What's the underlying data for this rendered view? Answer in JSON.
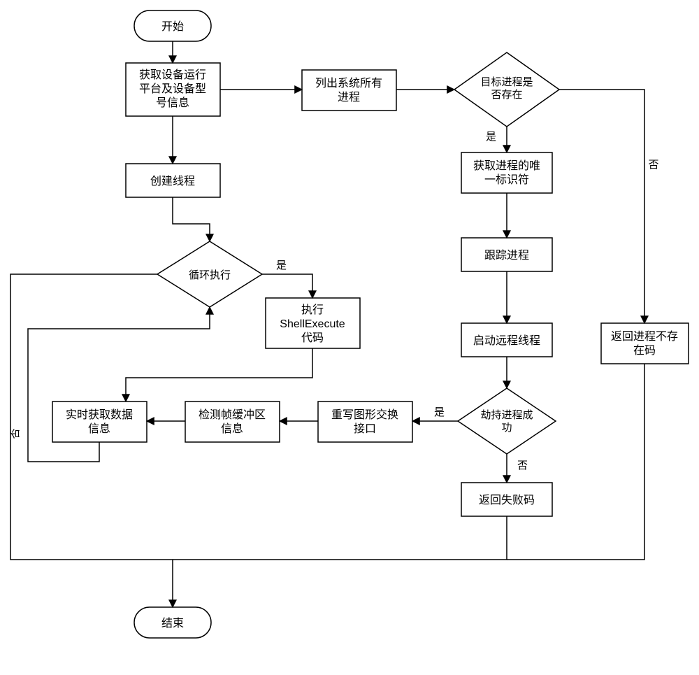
{
  "chart_data": {
    "type": "flowchart",
    "nodes": {
      "start": {
        "kind": "terminator",
        "label": "开始"
      },
      "n1": {
        "kind": "process",
        "label": "获取设备运行平台及设备型号信息"
      },
      "n2": {
        "kind": "process",
        "label": "列出系统所有进程"
      },
      "d1": {
        "kind": "decision",
        "label": "目标进程是否存在"
      },
      "n3": {
        "kind": "process",
        "label": "获取进程的唯一标识符"
      },
      "n4": {
        "kind": "process",
        "label": "跟踪进程"
      },
      "n5": {
        "kind": "process",
        "label": "启动远程线程"
      },
      "d2": {
        "kind": "decision",
        "label": "劫持进程成功"
      },
      "n_fail": {
        "kind": "process",
        "label": "返回失败码"
      },
      "n_notexist": {
        "kind": "process",
        "label": "返回进程不存在码"
      },
      "n_rewrite": {
        "kind": "process",
        "label": "重写图形交换接口"
      },
      "n_detect": {
        "kind": "process",
        "label": "检测帧缓冲区信息"
      },
      "n_realtime": {
        "kind": "process",
        "label": "实时获取数据信息"
      },
      "n_create": {
        "kind": "process",
        "label": "创建线程"
      },
      "d_loop": {
        "kind": "decision",
        "label": "循环执行"
      },
      "n_shell": {
        "kind": "process",
        "label": "执行 ShellExecute 代码"
      },
      "end": {
        "kind": "terminator",
        "label": "结束"
      }
    },
    "edges": [
      {
        "from": "start",
        "to": "n1"
      },
      {
        "from": "n1",
        "to": "n2"
      },
      {
        "from": "n2",
        "to": "d1"
      },
      {
        "from": "d1",
        "to": "n3",
        "label": "是"
      },
      {
        "from": "d1",
        "to": "n_notexist",
        "label": "否"
      },
      {
        "from": "n3",
        "to": "n4"
      },
      {
        "from": "n4",
        "to": "n5"
      },
      {
        "from": "n5",
        "to": "d2"
      },
      {
        "from": "d2",
        "to": "n_rewrite",
        "label": "是"
      },
      {
        "from": "d2",
        "to": "n_fail",
        "label": "否"
      },
      {
        "from": "n_rewrite",
        "to": "n_detect"
      },
      {
        "from": "n_detect",
        "to": "n_realtime"
      },
      {
        "from": "n1",
        "to": "n_create"
      },
      {
        "from": "n_create",
        "to": "d_loop"
      },
      {
        "from": "d_loop",
        "to": "n_shell",
        "label": "是"
      },
      {
        "from": "n_shell",
        "to": "n_realtime"
      },
      {
        "from": "n_realtime",
        "to": "d_loop"
      },
      {
        "from": "d_loop",
        "to": "end",
        "label": "否"
      },
      {
        "from": "n_fail",
        "to": "end"
      },
      {
        "from": "n_notexist",
        "to": "end"
      }
    ],
    "edge_labels": {
      "yes": "是",
      "no": "否"
    }
  }
}
